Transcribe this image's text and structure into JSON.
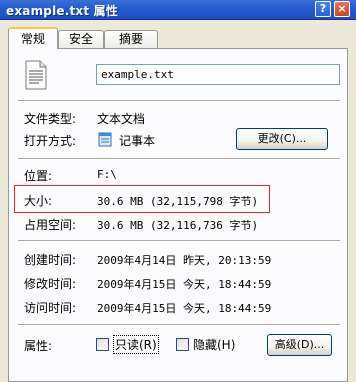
{
  "window": {
    "title": "example.txt 属性",
    "help_label": "?",
    "close_label": "×"
  },
  "tabs": [
    {
      "label": "常规",
      "active": true
    },
    {
      "label": "安全",
      "active": false
    },
    {
      "label": "摘要",
      "active": false
    }
  ],
  "general": {
    "file_name": "example.txt",
    "file_type_label": "文件类型:",
    "file_type_value": "文本文档",
    "open_with_label": "打开方式:",
    "open_with_value": "记事本",
    "change_button": "更改(C)...",
    "location_label": "位置:",
    "location_value": "F:\\",
    "size_label": "大小:",
    "size_value": "30.6 MB (32,115,798 字节)",
    "size_on_disk_label": "占用空间:",
    "size_on_disk_value": "30.6 MB (32,116,736 字节)",
    "created_label": "创建时间:",
    "created_value": "2009年4月14日 昨天, 20:13:59",
    "modified_label": "修改时间:",
    "modified_value": "2009年4月15日 今天, 18:44:59",
    "accessed_label": "访问时间:",
    "accessed_value": "2009年4月15日 今天, 18:44:59",
    "attributes_label": "属性:",
    "readonly_label": "只读(R)",
    "readonly_checked": false,
    "hidden_label": "隐藏(H)",
    "hidden_checked": false,
    "advanced_button": "高级(D)..."
  },
  "colors": {
    "titlebar": "#255ad0",
    "highlight_box": "#e8262c",
    "active_tab_accent": "#ffc73c",
    "dialog_bg": "#ece9d8"
  },
  "icons": {
    "file": "text-document-icon",
    "open_with": "notepad-icon"
  }
}
